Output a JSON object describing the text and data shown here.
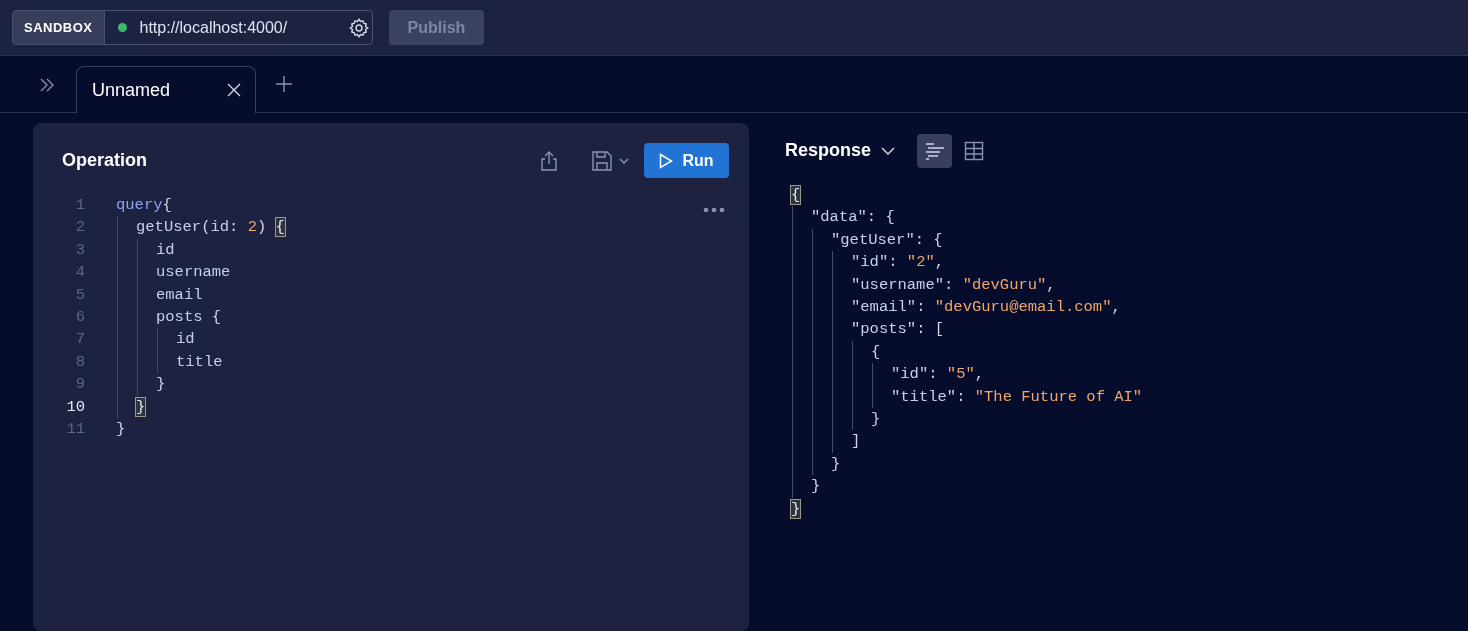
{
  "header": {
    "sandbox_label": "SANDBOX",
    "endpoint": {
      "url": "http://localhost:4000/",
      "online": true
    },
    "publish": {
      "label": "Publish",
      "disabled": true
    }
  },
  "tabs": [
    {
      "label": "Unnamed",
      "selected": true
    }
  ],
  "operation": {
    "title": "Operation",
    "run_label": "Run",
    "lines": [
      {
        "number": "1",
        "active": false,
        "tokens": [
          {
            "kind": "keyword",
            "text": "query"
          },
          {
            "kind": "punct",
            "text": "{"
          }
        ],
        "children": [
          {
            "number": "2",
            "active": false,
            "tokens": [
              {
                "kind": "field",
                "text": "getUser"
              },
              {
                "kind": "punct",
                "text": "("
              },
              {
                "kind": "field",
                "text": "id"
              },
              {
                "kind": "punct",
                "text": ": "
              },
              {
                "kind": "number",
                "text": "2"
              },
              {
                "kind": "punct",
                "text": ") "
              },
              {
                "kind": "match",
                "text": "{"
              }
            ],
            "children": [
              {
                "number": "3",
                "active": false,
                "tokens": [
                  {
                    "kind": "field",
                    "text": "id"
                  }
                ]
              },
              {
                "number": "4",
                "active": false,
                "tokens": [
                  {
                    "kind": "field",
                    "text": "username"
                  }
                ]
              },
              {
                "number": "5",
                "active": false,
                "tokens": [
                  {
                    "kind": "field",
                    "text": "email"
                  }
                ]
              },
              {
                "number": "6",
                "active": false,
                "tokens": [
                  {
                    "kind": "field",
                    "text": "posts"
                  },
                  {
                    "kind": "punct",
                    "text": " {"
                  }
                ],
                "children": [
                  {
                    "number": "7",
                    "active": false,
                    "tokens": [
                      {
                        "kind": "field",
                        "text": "id"
                      }
                    ]
                  },
                  {
                    "number": "8",
                    "active": false,
                    "tokens": [
                      {
                        "kind": "field",
                        "text": "title"
                      }
                    ]
                  }
                ]
              },
              {
                "number": "9",
                "active": false,
                "tokens": [
                  {
                    "kind": "punct",
                    "text": "}"
                  }
                ]
              }
            ]
          },
          {
            "number": "10",
            "active": true,
            "tokens": [
              {
                "kind": "match",
                "text": "}"
              }
            ]
          }
        ]
      },
      {
        "number": "11",
        "active": false,
        "tokens": [
          {
            "kind": "punct",
            "text": "}"
          }
        ]
      }
    ]
  },
  "response": {
    "title": "Response",
    "views": [
      {
        "kind": "list",
        "selected": true
      },
      {
        "kind": "table",
        "selected": false
      }
    ],
    "lines": [
      {
        "tokens": [
          {
            "kind": "match",
            "text": "{"
          }
        ],
        "children": [
          {
            "tokens": [
              {
                "kind": "key",
                "text": "\"data\""
              },
              {
                "kind": "punct",
                "text": ": {"
              }
            ],
            "children": [
              {
                "tokens": [
                  {
                    "kind": "key",
                    "text": "\"getUser\""
                  },
                  {
                    "kind": "punct",
                    "text": ": {"
                  }
                ],
                "children": [
                  {
                    "tokens": [
                      {
                        "kind": "key",
                        "text": "\"id\""
                      },
                      {
                        "kind": "punct",
                        "text": ": "
                      },
                      {
                        "kind": "string",
                        "text": "\"2\""
                      },
                      {
                        "kind": "punct",
                        "text": ","
                      }
                    ]
                  },
                  {
                    "tokens": [
                      {
                        "kind": "key",
                        "text": "\"username\""
                      },
                      {
                        "kind": "punct",
                        "text": ": "
                      },
                      {
                        "kind": "string",
                        "text": "\"devGuru\""
                      },
                      {
                        "kind": "punct",
                        "text": ","
                      }
                    ]
                  },
                  {
                    "tokens": [
                      {
                        "kind": "key",
                        "text": "\"email\""
                      },
                      {
                        "kind": "punct",
                        "text": ": "
                      },
                      {
                        "kind": "string",
                        "text": "\"devGuru@email.com\""
                      },
                      {
                        "kind": "punct",
                        "text": ","
                      }
                    ]
                  },
                  {
                    "tokens": [
                      {
                        "kind": "key",
                        "text": "\"posts\""
                      },
                      {
                        "kind": "punct",
                        "text": ": ["
                      }
                    ],
                    "children": [
                      {
                        "tokens": [
                          {
                            "kind": "punct",
                            "text": "{"
                          }
                        ],
                        "children": [
                          {
                            "tokens": [
                              {
                                "kind": "key",
                                "text": "\"id\""
                              },
                              {
                                "kind": "punct",
                                "text": ": "
                              },
                              {
                                "kind": "string",
                                "text": "\"5\""
                              },
                              {
                                "kind": "punct",
                                "text": ","
                              }
                            ]
                          },
                          {
                            "tokens": [
                              {
                                "kind": "key",
                                "text": "\"title\""
                              },
                              {
                                "kind": "punct",
                                "text": ": "
                              },
                              {
                                "kind": "string",
                                "text": "\"The Future of AI\""
                              }
                            ]
                          }
                        ]
                      },
                      {
                        "tokens": [
                          {
                            "kind": "punct",
                            "text": "}"
                          }
                        ]
                      }
                    ]
                  },
                  {
                    "tokens": [
                      {
                        "kind": "punct",
                        "text": "]"
                      }
                    ]
                  }
                ]
              },
              {
                "tokens": [
                  {
                    "kind": "punct",
                    "text": "}"
                  }
                ]
              }
            ]
          },
          {
            "tokens": [
              {
                "kind": "punct",
                "text": "}"
              }
            ]
          }
        ]
      },
      {
        "tokens": [
          {
            "kind": "match",
            "text": "}"
          }
        ]
      }
    ]
  }
}
